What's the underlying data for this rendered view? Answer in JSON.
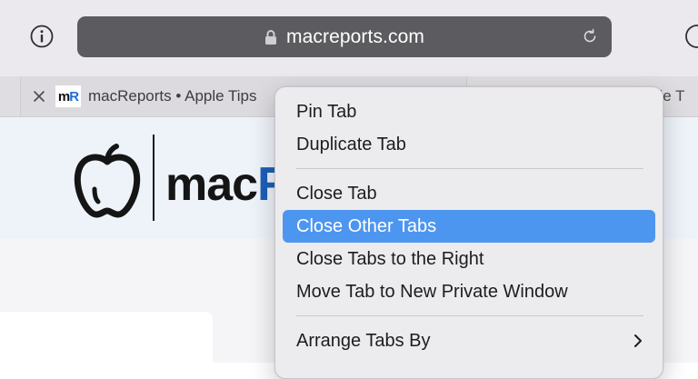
{
  "address_bar": {
    "url": "macreports.com"
  },
  "tabs": [
    {
      "title": "macReports • Apple Tips",
      "favicon_text": [
        "m",
        "R"
      ]
    },
    {
      "title": "ple T"
    }
  ],
  "page": {
    "logo_text": [
      "mac",
      "R"
    ]
  },
  "context_menu": {
    "items": [
      {
        "label": "Pin Tab"
      },
      {
        "label": "Duplicate Tab"
      },
      {
        "label": "Close Tab"
      },
      {
        "label": "Close Other Tabs"
      },
      {
        "label": "Close Tabs to the Right"
      },
      {
        "label": "Move Tab to New Private Window"
      },
      {
        "label": "Arrange Tabs By"
      }
    ],
    "highlighted_item": "Close Other Tabs"
  },
  "colors": {
    "menu_highlight": "#4d96f0",
    "address_bar": "#5c5b5f",
    "logo_blue": "#1c5fb8"
  },
  "icons": [
    "info-icon",
    "lock-icon",
    "reload-icon",
    "close-icon",
    "apple-logo-icon",
    "chevron-right-icon"
  ]
}
